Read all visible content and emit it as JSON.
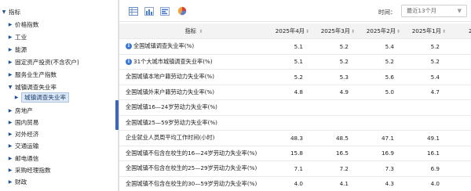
{
  "tree": {
    "items": [
      {
        "label": "指标",
        "arrow": "▼",
        "indent": 0
      },
      {
        "label": "价格指数",
        "arrow": "▶",
        "indent": 1
      },
      {
        "label": "工业",
        "arrow": "▶",
        "indent": 1
      },
      {
        "label": "能源",
        "arrow": "▶",
        "indent": 1
      },
      {
        "label": "固定资产投资(不含农户)",
        "arrow": "▶",
        "indent": 1
      },
      {
        "label": "服务业生产指数",
        "arrow": "▶",
        "indent": 1
      },
      {
        "label": "城镇调查失业率",
        "arrow": "▼",
        "indent": 1
      },
      {
        "label": "城镇调查失业率",
        "arrow": "▶",
        "indent": 2,
        "selected": true
      },
      {
        "label": "房地产",
        "arrow": "▶",
        "indent": 1
      },
      {
        "label": "国内贸易",
        "arrow": "▶",
        "indent": 1
      },
      {
        "label": "对外经济",
        "arrow": "▶",
        "indent": 1
      },
      {
        "label": "交通运输",
        "arrow": "▶",
        "indent": 1
      },
      {
        "label": "邮电通信",
        "arrow": "▶",
        "indent": 1
      },
      {
        "label": "采购经理指数",
        "arrow": "▶",
        "indent": 1
      },
      {
        "label": "财政",
        "arrow": "▶",
        "indent": 1
      }
    ]
  },
  "toolbar": {
    "time_label": "时间：",
    "time_value": "最近13个月",
    "caret": "▼"
  },
  "table": {
    "indicator_header": "指标",
    "sort_glyph": "⬍",
    "columns": [
      "2025年4月",
      "2025年3月",
      "2025年2月",
      "2025年1月",
      "20"
    ],
    "rows": [
      {
        "name": "全国城镇调查失业率(%)",
        "info": true,
        "values": [
          "5.1",
          "5.2",
          "5.4",
          "5.2",
          ""
        ]
      },
      {
        "name": "31个大城市城镇调查失业率(%)",
        "info": true,
        "values": [
          "5.1",
          "5.2",
          "5.2",
          "5.2",
          ""
        ]
      },
      {
        "name": "全国城镇本地户籍劳动力失业率(%)",
        "info": false,
        "values": [
          "5.2",
          "5.3",
          "5.6",
          "5.4",
          ""
        ]
      },
      {
        "name": "全国城镇外来户籍劳动力失业率(%)",
        "info": false,
        "values": [
          "4.8",
          "4.9",
          "5.0",
          "4.7",
          ""
        ]
      },
      {
        "name": "全国城镇16—24岁劳动力失业率(%)",
        "info": false,
        "values": [
          "",
          "",
          "",
          "",
          ""
        ]
      },
      {
        "name": "全国城镇25—59岁劳动力失业率(%)",
        "info": false,
        "values": [
          "",
          "",
          "",
          "",
          ""
        ]
      },
      {
        "name": "企业就业人员周平均工作时间(小时)",
        "info": false,
        "values": [
          "48.3",
          "48.5",
          "47.1",
          "49.1",
          ""
        ]
      },
      {
        "name": "全国城镇不包含在校生的16—24岁劳动力失业率(%)",
        "info": false,
        "values": [
          "15.8",
          "16.5",
          "16.9",
          "16.1",
          ""
        ]
      },
      {
        "name": "全国城镇不包含在校生的25—29岁劳动力失业率(%)",
        "info": false,
        "values": [
          "7.1",
          "7.2",
          "7.3",
          "6.9",
          ""
        ]
      },
      {
        "name": "全国城镇不包含在校生的30—59岁劳动力失业率(%)",
        "info": false,
        "values": [
          "4.0",
          "4.1",
          "4.3",
          "4.0",
          ""
        ]
      }
    ]
  },
  "colors": {
    "accent": "#3a64c5",
    "tree_arrow": "#1e4f9a",
    "info_icon": "#3a78d4",
    "header_bg": "#f3f3f3"
  }
}
